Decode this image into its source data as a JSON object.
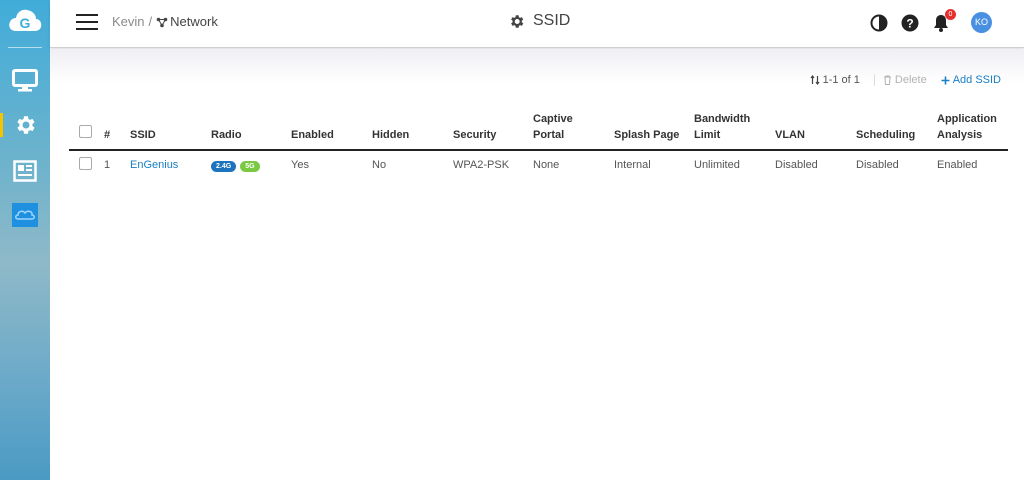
{
  "header": {
    "breadcrumb": {
      "parent": "Kevin",
      "separator": "/",
      "current": "Network"
    },
    "title": "SSID",
    "notification_count": "0",
    "user_initials": "KO"
  },
  "sidebar": {
    "items": [
      {
        "icon": "monitor-icon"
      },
      {
        "icon": "gear-icon",
        "active": true
      },
      {
        "icon": "newspaper-icon"
      },
      {
        "icon": "cloud-icon"
      }
    ]
  },
  "toolbar": {
    "pagination": "1-1 of 1",
    "delete_label": "Delete",
    "add_label": "Add SSID"
  },
  "table": {
    "headers": [
      "#",
      "SSID",
      "Radio",
      "Enabled",
      "Hidden",
      "Security",
      "Captive Portal",
      "Splash Page",
      "Bandwidth Limit",
      "VLAN",
      "Scheduling",
      "Application Analysis"
    ],
    "rows": [
      {
        "index": "1",
        "ssid": "EnGenius",
        "radio": [
          "2.4G",
          "5G"
        ],
        "enabled": "Yes",
        "hidden": "No",
        "security": "WPA2-PSK",
        "captive_portal": "None",
        "splash_page": "Internal",
        "bandwidth_limit": "Unlimited",
        "vlan": "Disabled",
        "scheduling": "Disabled",
        "application_analysis": "Enabled"
      }
    ]
  },
  "colors": {
    "accent": "#1a7ec4",
    "active_indicator": "#f5c400",
    "radio_24": "#1e73be",
    "radio_5": "#7ac943",
    "badge": "#e63030"
  }
}
